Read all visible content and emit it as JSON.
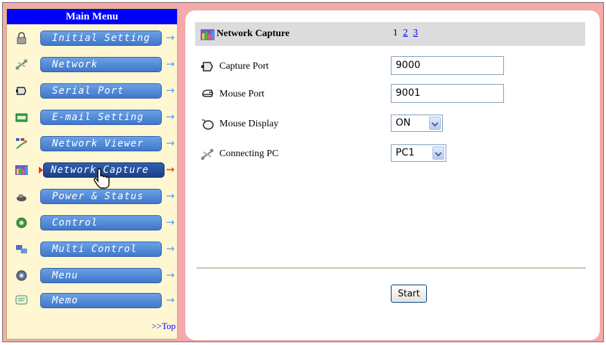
{
  "sidebar": {
    "title": "Main Menu",
    "items": [
      {
        "label": "Initial Setting",
        "icon": "lock-icon"
      },
      {
        "label": "Network",
        "icon": "network-icon"
      },
      {
        "label": "Serial Port",
        "icon": "serial-port-icon"
      },
      {
        "label": "E-mail Setting",
        "icon": "email-icon"
      },
      {
        "label": "Network Viewer",
        "icon": "network-viewer-icon"
      },
      {
        "label": "Network Capture",
        "icon": "network-capture-icon",
        "active": true
      },
      {
        "label": "Power & Status",
        "icon": "power-icon"
      },
      {
        "label": "Control",
        "icon": "control-icon"
      },
      {
        "label": "Multi Control",
        "icon": "multi-control-icon"
      },
      {
        "label": "Menu",
        "icon": "menu-icon"
      },
      {
        "label": "Memo",
        "icon": "memo-icon"
      }
    ],
    "arrow": "→",
    "top_link": ">>Top"
  },
  "main": {
    "header": {
      "title": "Network Capture",
      "pages": [
        "1",
        "2",
        "3"
      ],
      "current_page": "1"
    },
    "fields": {
      "capture_port": {
        "label": "Capture Port",
        "value": "9000"
      },
      "mouse_port": {
        "label": "Mouse Port",
        "value": "9001"
      },
      "mouse_display": {
        "label": "Mouse Display",
        "value": "ON"
      },
      "connecting_pc": {
        "label": "Connecting PC",
        "value": "PC1"
      }
    },
    "start_label": "Start"
  },
  "colors": {
    "frame_bg": "#f4a9aa",
    "menu_title_bg": "#0000ff",
    "button_blue": "#4a84d6",
    "active_button": "#1f4590",
    "active_arrow": "#f05020"
  }
}
